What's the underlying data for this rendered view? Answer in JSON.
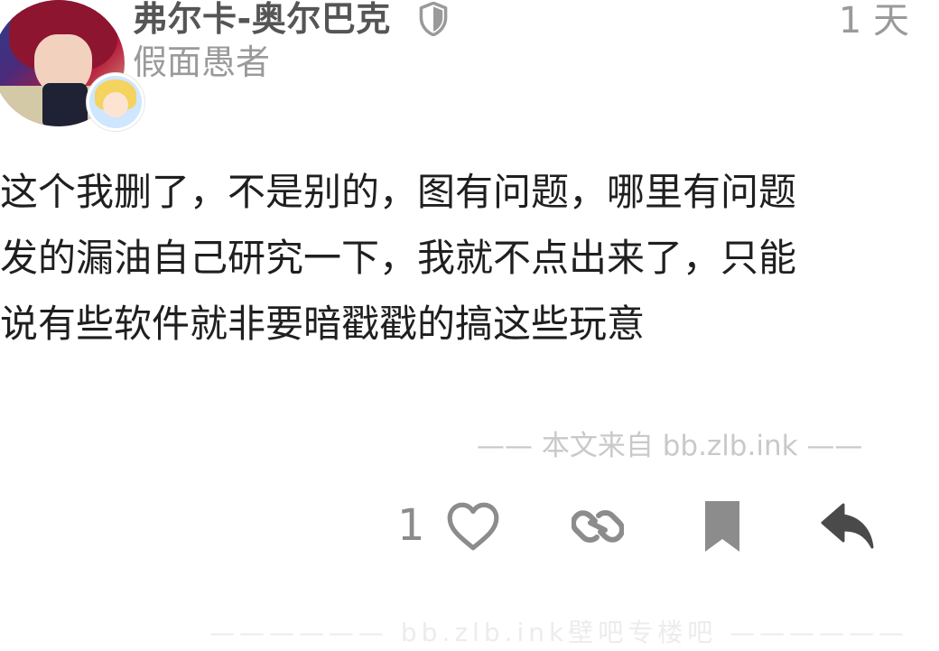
{
  "post": {
    "author": {
      "username": "弗尔卡-奥尔巴克",
      "title": "假面愚者",
      "moderator_icon": "shield-icon"
    },
    "time": "1 天",
    "body_lines": [
      "这个我删了，不是别的，图有问题，哪里有问题",
      "发的漏油自己研究一下，我就不点出来了，只能",
      "说有些软件就非要暗戳戳的搞这些玩意"
    ],
    "source_note": "—— 本文来自 bb.zlb.ink ——",
    "actions": {
      "like_count": "1",
      "like_icon": "heart-icon",
      "share_icon": "link-icon",
      "bookmark_icon": "bookmark-icon",
      "reply_icon": "reply-icon"
    }
  },
  "footer": {
    "watermark": "—————— bb.zlb.ink壁吧专楼吧 ——————"
  },
  "colors": {
    "username": "#555555",
    "muted": "#9a9a9a",
    "body_text": "#1f1f1f",
    "icon": "#8c8c8c",
    "watermark": "#c9c9c9"
  }
}
